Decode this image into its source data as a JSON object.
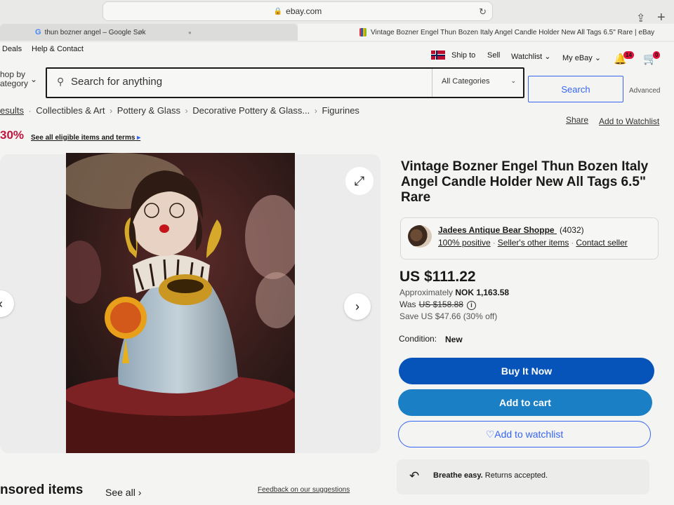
{
  "browser": {
    "url": "ebay.com",
    "tabs": [
      {
        "label": "thun bozner angel – Google Søk"
      },
      {
        "label": "Vintage Bozner Engel Thun Bozen Italy Angel Candle Holder New All Tags 6.5\" Rare | eBay"
      }
    ]
  },
  "topnav": {
    "deals": "Deals",
    "help": "Help & Contact",
    "ship_to": "Ship to",
    "sell": "Sell",
    "watchlist": "Watchlist",
    "my_ebay": "My eBay",
    "notif_count": "14",
    "cart_count": "0"
  },
  "search": {
    "shop_by_line1": "hop by",
    "shop_by_line2": "ategory",
    "placeholder": "Search for anything",
    "category": "All Categories",
    "button": "Search",
    "advanced": "Advanced"
  },
  "breadcrumb": {
    "items": [
      "esults",
      "Collectibles & Art",
      "Pottery & Glass",
      "Decorative Pottery & Glass...",
      "Figurines"
    ],
    "share": "Share",
    "add_watch": "Add to Watchlist"
  },
  "promo": {
    "percent": "30%",
    "link": "See all eligible items and terms"
  },
  "listing": {
    "title": "Vintage Bozner Engel Thun Bozen Italy Angel Candle Holder New All Tags 6.5\" Rare",
    "seller": {
      "name": "Jadees Antique Bear Shoppe",
      "count": "(4032)",
      "positive": "100% positive",
      "other_items": "Seller's other items",
      "contact": "Contact seller"
    },
    "price": "US $111.22",
    "approx_label": "Approximately",
    "approx_value": "NOK 1,163.58",
    "was_label": "Was",
    "was_value": "US $158.88",
    "save": "Save US $47.66 (30% off)",
    "condition_label": "Condition:",
    "condition_value": "New",
    "buy_now": "Buy It Now",
    "add_cart": "Add to cart",
    "add_watchlist": "Add to watchlist",
    "returns_bold": "Breathe easy.",
    "returns_text": "Returns accepted."
  },
  "footer": {
    "sponsored": "nsored items",
    "see_all": "See all",
    "feedback": "Feedback on our suggestions"
  },
  "colors": {
    "buy_now": "#0654ba",
    "add_cart": "#1a7fc4",
    "accent": "#3665f3",
    "promo": "#c0143c"
  }
}
